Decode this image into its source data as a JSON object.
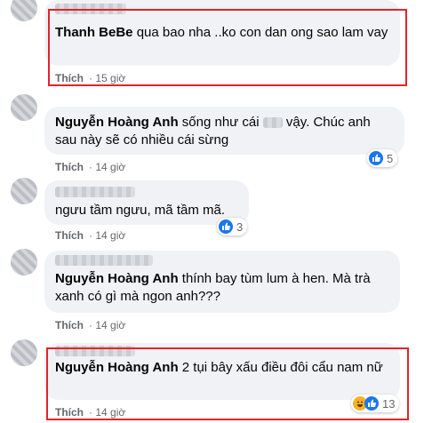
{
  "comments": [
    {
      "name": "Thanh BeBe",
      "text": "qua bao nha ..ko con dan ong sao lam vay",
      "like_label": "Thích",
      "time": "15 giờ"
    },
    {
      "name": "Nguyễn Hoàng Anh",
      "text_before": "sống như cái",
      "text_after": "vậy. Chúc anh sau này sẽ có nhiều cái sừng",
      "like_label": "Thích",
      "time": "14 giờ",
      "reaction_count": "5"
    },
    {
      "text": "ngưu tầm ngưu, mã tầm mã.",
      "like_label": "Thích",
      "time": "14 giờ",
      "reaction_count": "3"
    },
    {
      "name": "Nguyễn Hoàng Anh",
      "text": "thính bay tùm lum à hen. Mà trà xanh có gì mà ngon anh???",
      "like_label": "Thích",
      "time": "14 giờ"
    },
    {
      "name": "Nguyễn Hoàng Anh",
      "text": "2 tụi bây xấu điều đôi cẩu nam nữ",
      "like_label": "Thích",
      "time": "14 giờ",
      "reaction_count": "13"
    }
  ],
  "colors": {
    "bubble": "#f0f2f5",
    "highlight_box": "#e3232c",
    "like_blue": "#1877f2",
    "meta_gray": "#65676b"
  },
  "icons": {
    "like": "thumbs-up-icon",
    "haha": "laugh-icon"
  }
}
